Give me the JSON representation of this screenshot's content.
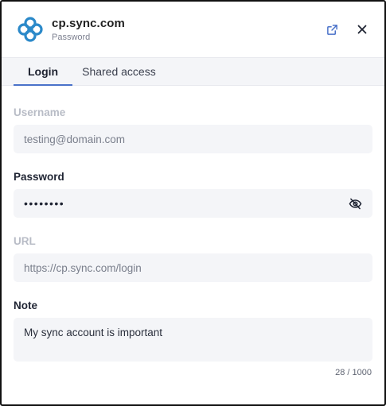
{
  "header": {
    "title": "cp.sync.com",
    "subtitle": "Password",
    "logo_icon": "sync-logo-icon",
    "open_icon": "external-link-icon",
    "close_icon": "close-icon"
  },
  "tabs": [
    {
      "label": "Login",
      "active": true
    },
    {
      "label": "Shared access",
      "active": false
    }
  ],
  "form": {
    "username": {
      "label": "Username",
      "value": "testing@domain.com"
    },
    "password": {
      "label": "Password",
      "value": "••••••••",
      "toggle_icon": "eye-slash-icon"
    },
    "url": {
      "label": "URL",
      "value": "https://cp.sync.com/login"
    },
    "note": {
      "label": "Note",
      "value": "My sync account is important",
      "counter": "28 / 1000"
    }
  },
  "colors": {
    "accent": "#4a72c9",
    "logo": "#2b89c9",
    "field_bg": "#f4f5f8",
    "muted_label": "#b8bcc6"
  }
}
